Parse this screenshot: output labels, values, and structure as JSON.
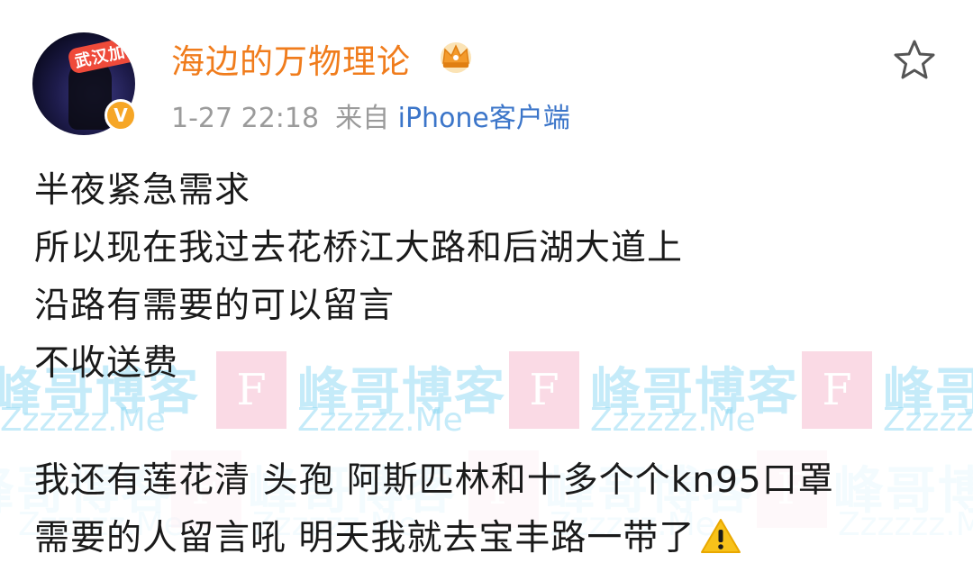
{
  "header": {
    "avatar_badge_text": "武汉加油！",
    "username": "海边的万物理论",
    "verified_mark": "V",
    "time": "1-27 22:18",
    "source_prefix": "来自",
    "source": "iPhone客户端"
  },
  "post": {
    "lines": [
      "半夜紧急需求",
      "所以现在我过去花桥江大路和后湖大道上",
      "沿路有需要的可以留言",
      "不收送费",
      "我还有莲花清 头孢 阿斯匹林和十多个个kn95口罩",
      "需要的人留言吼 明天我就去宝丰路一带了"
    ]
  },
  "watermark": {
    "logo_letter": "F",
    "cn": "峰哥博客",
    "en": "Zzzzzz.Me"
  },
  "icons": {
    "favorite": "star-outline-icon",
    "member": "crown-icon",
    "verified": "verified-badge-icon",
    "warning": "warning-icon"
  },
  "colors": {
    "username": "#f07c1c",
    "meta": "#9b9b9b",
    "source_link": "#3b75c9",
    "text": "#1a1a1a",
    "verified": "#f6a626",
    "watermark_text": "#7fd3f2",
    "watermark_logo": "#f6bcd0"
  }
}
